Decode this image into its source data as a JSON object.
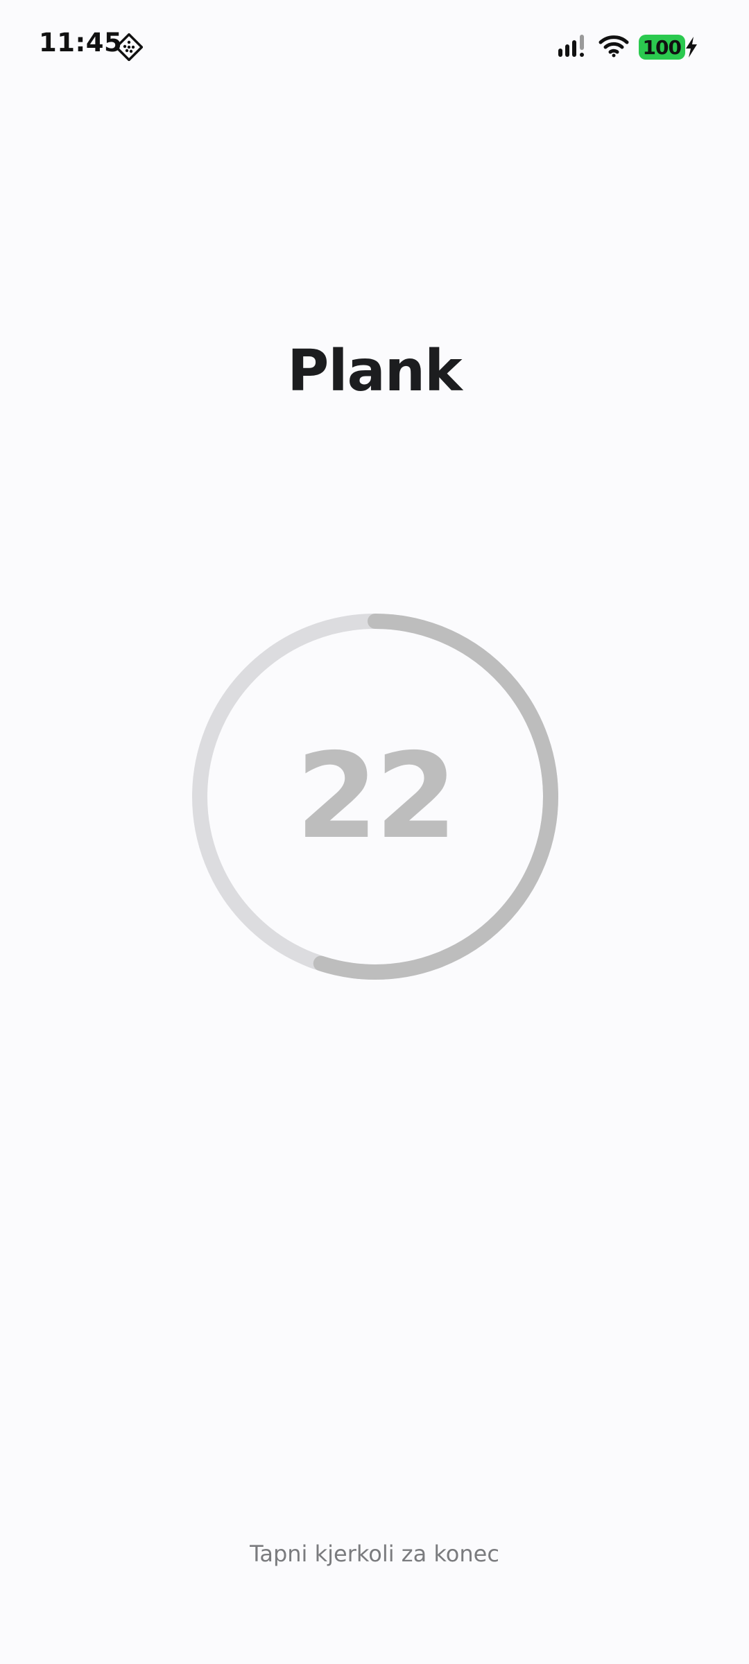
{
  "status_bar": {
    "time": "11:45",
    "app_icon": "diamond-grid-icon",
    "signal_icon": "cellular-signal-icon",
    "wifi_icon": "wifi-icon",
    "battery_level": "100",
    "battery_icon": "charging-bolt-icon",
    "battery_color": "#2bc94f"
  },
  "exercise": {
    "title": "Plank"
  },
  "timer": {
    "value": "22",
    "progress_fraction": 0.55,
    "ring_track_color": "#dcdcdf",
    "ring_progress_color": "#bdbdbd"
  },
  "footer": {
    "hint": "Tapni kjerkoli za konec"
  }
}
